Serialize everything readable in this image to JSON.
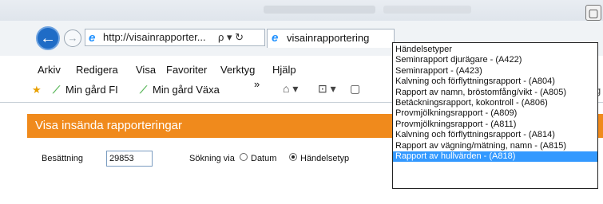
{
  "browser": {
    "url": "http://visainrapporter...",
    "address_controls": "ρ ▾ ↻",
    "tab_label": "visainrapportering",
    "back_glyph": "←",
    "forward_glyph": "→",
    "window_button": "▢"
  },
  "menubar": [
    "Arkiv",
    "Redigera",
    "Visa",
    "Favoriter",
    "Verktyg",
    "Hjälp"
  ],
  "favorites": {
    "item1": "Min gård FI",
    "item2": "Min gård Växa",
    "overflow": "»",
    "cut_letter": "g"
  },
  "page": {
    "header_title": "Visa insända rapporteringar",
    "besattning_label": "Besättning",
    "besattning_value": "29853",
    "sokning_label": "Sökning via",
    "radio_datum": "Datum",
    "radio_handelsetyp": "Händelsetyp"
  },
  "dropdown": {
    "options": [
      "Händelsetyper",
      "Seminrapport djurägare - (A422)",
      "Seminrapport - (A423)",
      "Kalvning och förflyttningsrapport - (A804)",
      "Rapport av namn, bröstomfång/vikt - (A805)",
      "Betäckningsrapport, kokontroll - (A806)",
      "Provmjölkningsrapport - (A809)",
      "Provmjölkningsrapport - (A811)",
      "Kalvning och förflyttningsrapport - (A814)",
      "Rapport av vägning/mätning, namn - (A815)",
      "Rapport av hullvärden - (A818)"
    ],
    "selected_index": 10
  }
}
